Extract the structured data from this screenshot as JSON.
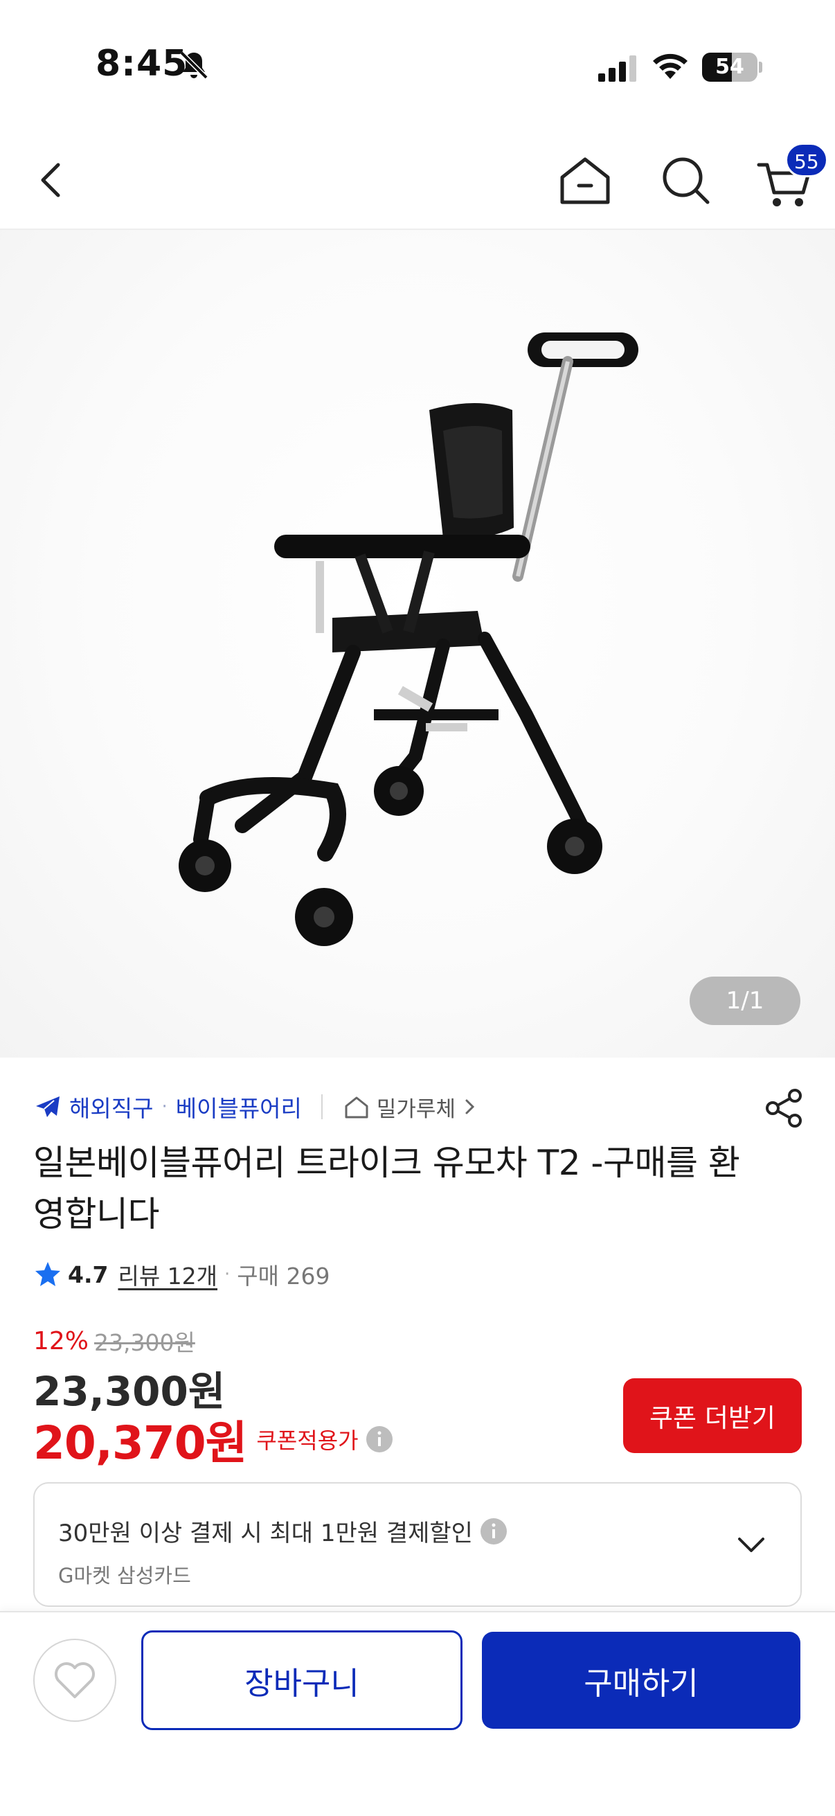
{
  "status_bar": {
    "time": "8:45",
    "battery": "54",
    "battery_level": 0.54
  },
  "nav": {
    "cart_badge": "55"
  },
  "gallery": {
    "counter": "1/1"
  },
  "seller": {
    "category": "해외직구",
    "separator": "·",
    "brand": "베이블퓨어리",
    "store": "밀가루체"
  },
  "product": {
    "title": "일본베이블퓨어리 트라이크 유모차 T2 -구매를 환영합니다",
    "rating": "4.7",
    "reviews": "리뷰 12개",
    "rating_separator": "·",
    "purchase": "구매 269"
  },
  "price": {
    "discount_rate": "12%",
    "original": "23,300원",
    "sale": "23,300원",
    "coupon_price": "20,370원",
    "coupon_label": "쿠폰적용가",
    "coupon_button": "쿠폰 더받기"
  },
  "payment": {
    "benefit": "30만원 이상 결제 시 최대 1만원 결제할인",
    "card": "G마켓 삼성카드"
  },
  "actions": {
    "cart": "장바구니",
    "buy": "구매하기"
  },
  "colors": {
    "brand_blue": "#0b2bb8",
    "sale_red": "#e0141a"
  }
}
